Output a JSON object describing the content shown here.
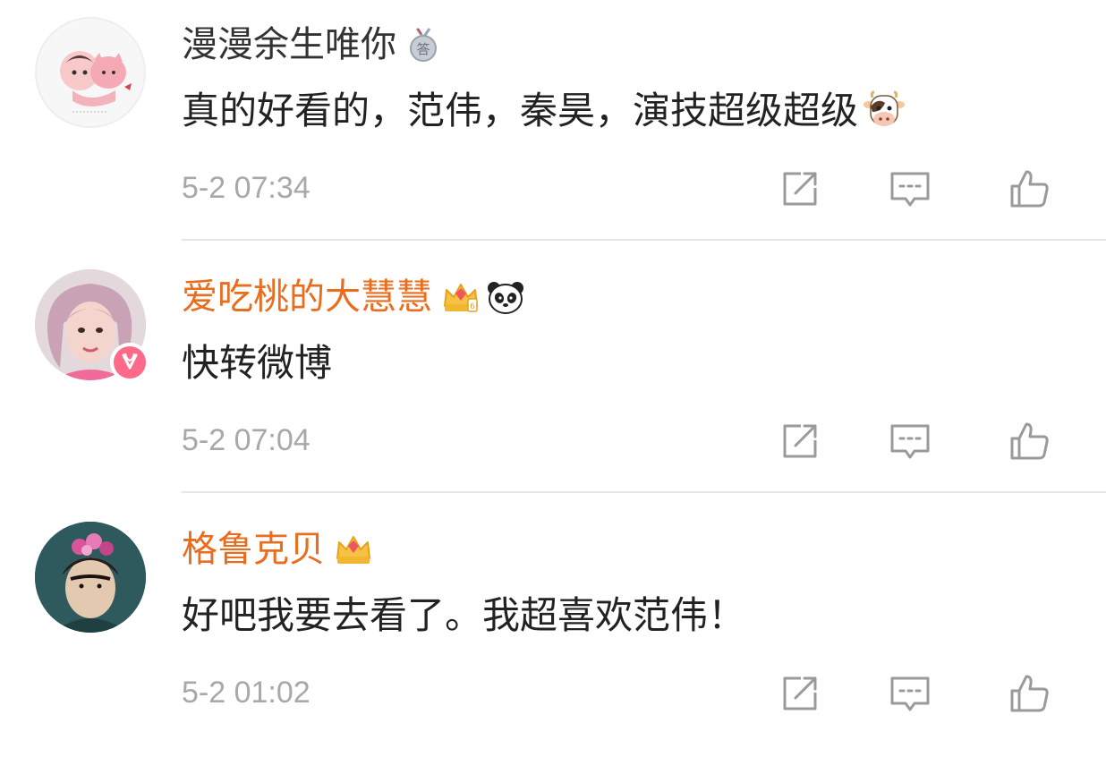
{
  "comments": [
    {
      "username": "漫漫余生唯你",
      "text": "真的好看的，范伟，秦昊，演技超级超级",
      "timestamp": "5-2 07:34",
      "badges": [
        "answer-medal-icon"
      ],
      "trailing_emoji": "cow-emoji-icon",
      "name_color": "#333333"
    },
    {
      "username": "爱吃桃的大慧慧",
      "text": "快转微博",
      "timestamp": "5-2 07:04",
      "badges": [
        "vip-crown-icon",
        "panda-icon"
      ],
      "name_color": "#e86d1f"
    },
    {
      "username": "格鲁克贝",
      "text": "好吧我要去看了。我超喜欢范伟！",
      "timestamp": "5-2 01:02",
      "badges": [
        "vip-crown-icon"
      ],
      "name_color": "#e86d1f"
    }
  ],
  "colors": {
    "vip_name": "#e86d1f",
    "timestamp": "#a8a8a8",
    "icon_gray": "#9a9a9a",
    "divider": "#e6e6e6"
  }
}
